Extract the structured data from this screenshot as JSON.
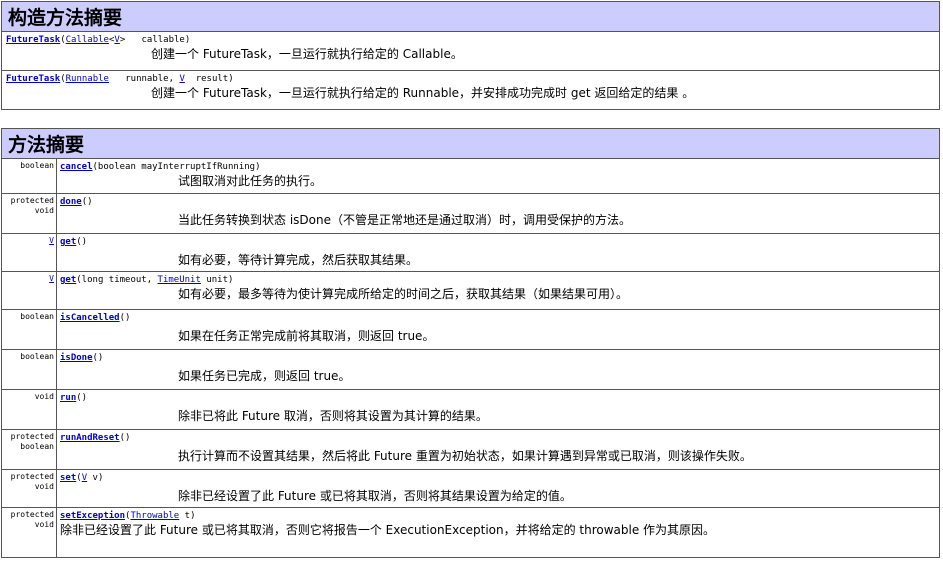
{
  "constructor_summary": {
    "title": "构造方法摘要",
    "rows": [
      {
        "name": "FutureTask",
        "params": [
          {
            "type": "Callable",
            "type_arg": "V",
            "name": "callable"
          }
        ],
        "description": "创建一个 FutureTask，一旦运行就执行给定的 Callable。"
      },
      {
        "name": "FutureTask",
        "params": [
          {
            "type": "Runnable",
            "name": "runnable,"
          },
          {
            "type": "V",
            "name": "result"
          }
        ],
        "description": "创建一个 FutureTask，一旦运行就执行给定的 Runnable，并安排成功完成时 get 返回给定的结果 。"
      }
    ]
  },
  "method_summary": {
    "title": "方法摘要",
    "rows": [
      {
        "modifier": [
          "boolean"
        ],
        "name": "cancel",
        "params_text": "(boolean  mayInterruptIfRunning)",
        "description": "试图取消对此任务的执行。"
      },
      {
        "modifier": [
          "protected",
          "void"
        ],
        "name": "done",
        "params_text": "()",
        "description": "当此任务转换到状态 isDone（不管是正常地还是通过取消）时，调用受保护的方法。"
      },
      {
        "modifier": [
          "V"
        ],
        "modifier_link": true,
        "name": "get",
        "params_text": "()",
        "description": "如有必要，等待计算完成，然后获取其结果。"
      },
      {
        "modifier": [
          "V"
        ],
        "modifier_link": true,
        "name": "get",
        "params_text": "(long  timeout, ",
        "param_link": "TimeUnit",
        "params_tail": " unit)",
        "description": "如有必要，最多等待为使计算完成所给定的时间之后，获取其结果（如果结果可用）。"
      },
      {
        "modifier": [
          "boolean"
        ],
        "name": "isCancelled",
        "params_text": "()",
        "description": "如果在任务正常完成前将其取消，则返回 true。"
      },
      {
        "modifier": [
          "boolean"
        ],
        "name": "isDone",
        "params_text": "()",
        "description": "如果任务已完成，则返回 true。"
      },
      {
        "modifier": [
          "void"
        ],
        "name": "run",
        "params_text": "()",
        "description": "除非已将此 Future 取消，否则将其设置为其计算的结果。"
      },
      {
        "modifier": [
          "protected",
          "boolean"
        ],
        "name": "runAndReset",
        "params_text": "()",
        "description": "执行计算而不设置其结果，然后将此 Future 重置为初始状态，如果计算遇到异常或已取消，则该操作失败。"
      },
      {
        "modifier": [
          "protected",
          "void"
        ],
        "name": "set",
        "params_text": "(",
        "param_link": "V",
        "params_tail": "  v)",
        "description": "除非已经设置了此 Future 或已将其取消，否则将其结果设置为给定的值。"
      },
      {
        "modifier": [
          "protected",
          "void"
        ],
        "name": "setException",
        "params_text": "(",
        "param_link": "Throwable",
        "params_tail": "  t)",
        "description": "除非已经设置了此 Future 或已将其取消，否则它将报告一个 ExecutionException，并将给定的 throwable 作为其原因。"
      }
    ]
  }
}
